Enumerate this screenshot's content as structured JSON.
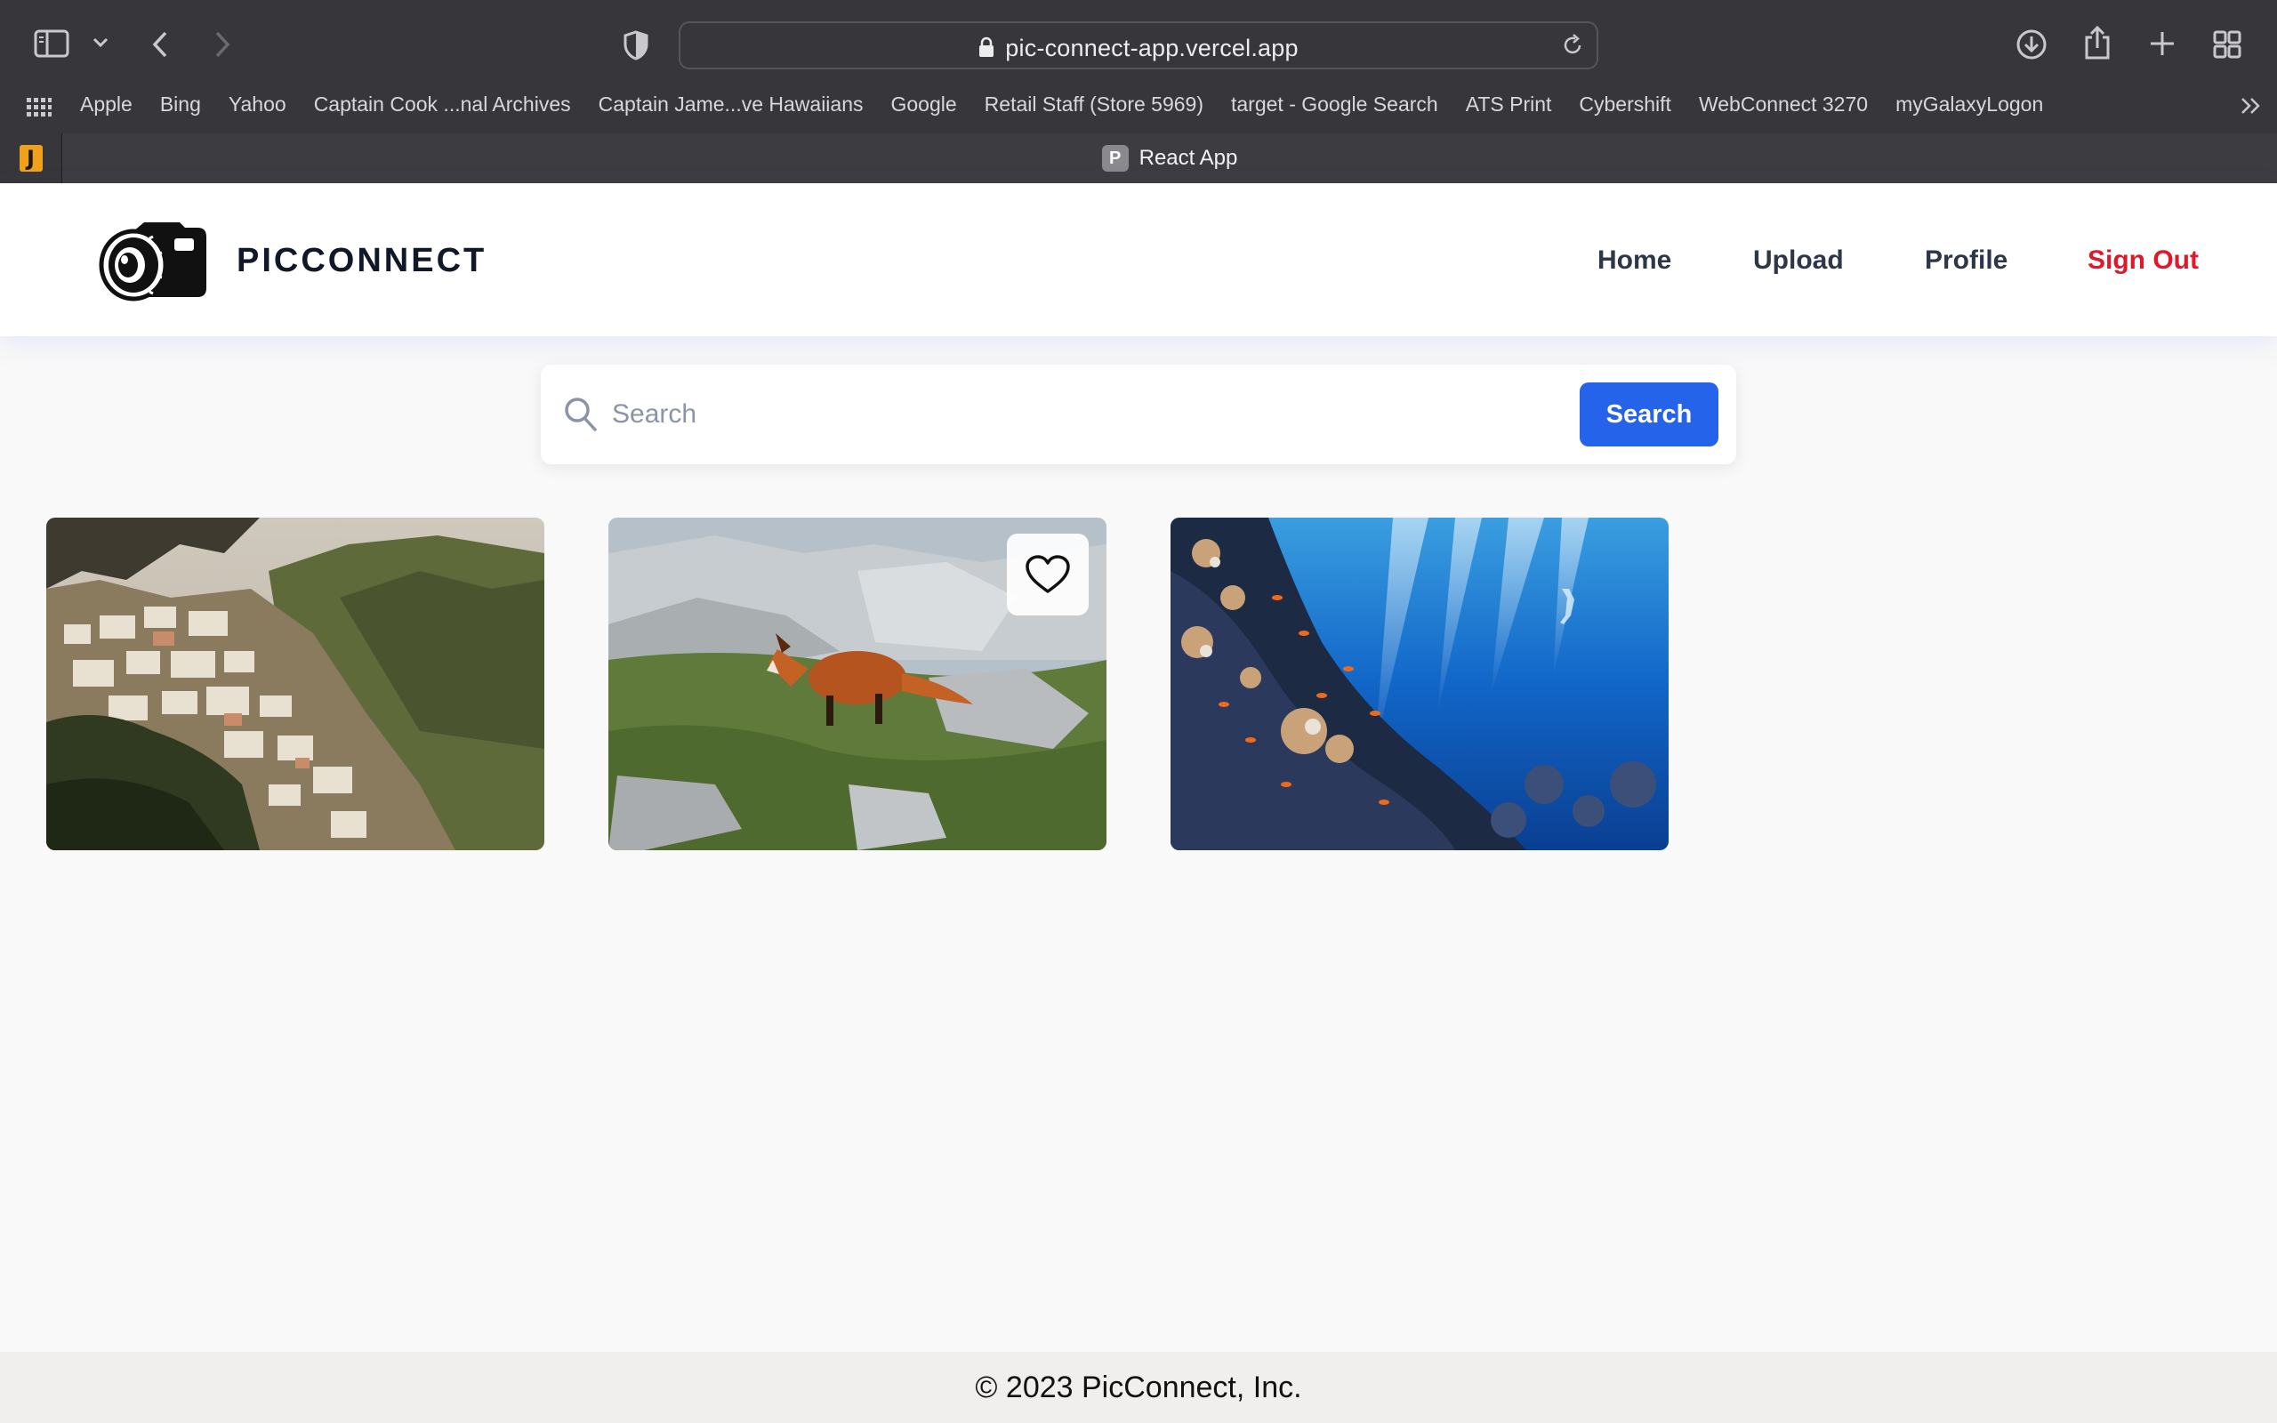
{
  "browser": {
    "url": "pic-connect-app.vercel.app",
    "tab_title": "React App",
    "tab_favicon_letter": "P",
    "pinned_tab_letter": "J",
    "bookmarks": [
      "Apple",
      "Bing",
      "Yahoo",
      "Captain Cook ...nal Archives",
      "Captain Jame...ve Hawaiians",
      "Google",
      "Retail Staff (Store 5969)",
      "target - Google Search",
      "ATS Print",
      "Cybershift",
      "WebConnect 3270",
      "myGalaxyLogon"
    ]
  },
  "header": {
    "brand": "PICCONNECT",
    "nav": {
      "home": "Home",
      "upload": "Upload",
      "profile": "Profile",
      "signout": "Sign Out"
    }
  },
  "search": {
    "placeholder": "Search",
    "value": "",
    "button_label": "Search"
  },
  "photos": [
    {
      "subject": "cliffside village",
      "favorite_visible": false
    },
    {
      "subject": "red fox on rocks",
      "favorite_visible": true
    },
    {
      "subject": "diver by coral reef",
      "favorite_visible": false
    }
  ],
  "footer": {
    "copyright": "© 2023 PicConnect, Inc."
  },
  "colors": {
    "accent": "#2563eb",
    "signout": "#e0192a",
    "chrome": "#37363b"
  }
}
